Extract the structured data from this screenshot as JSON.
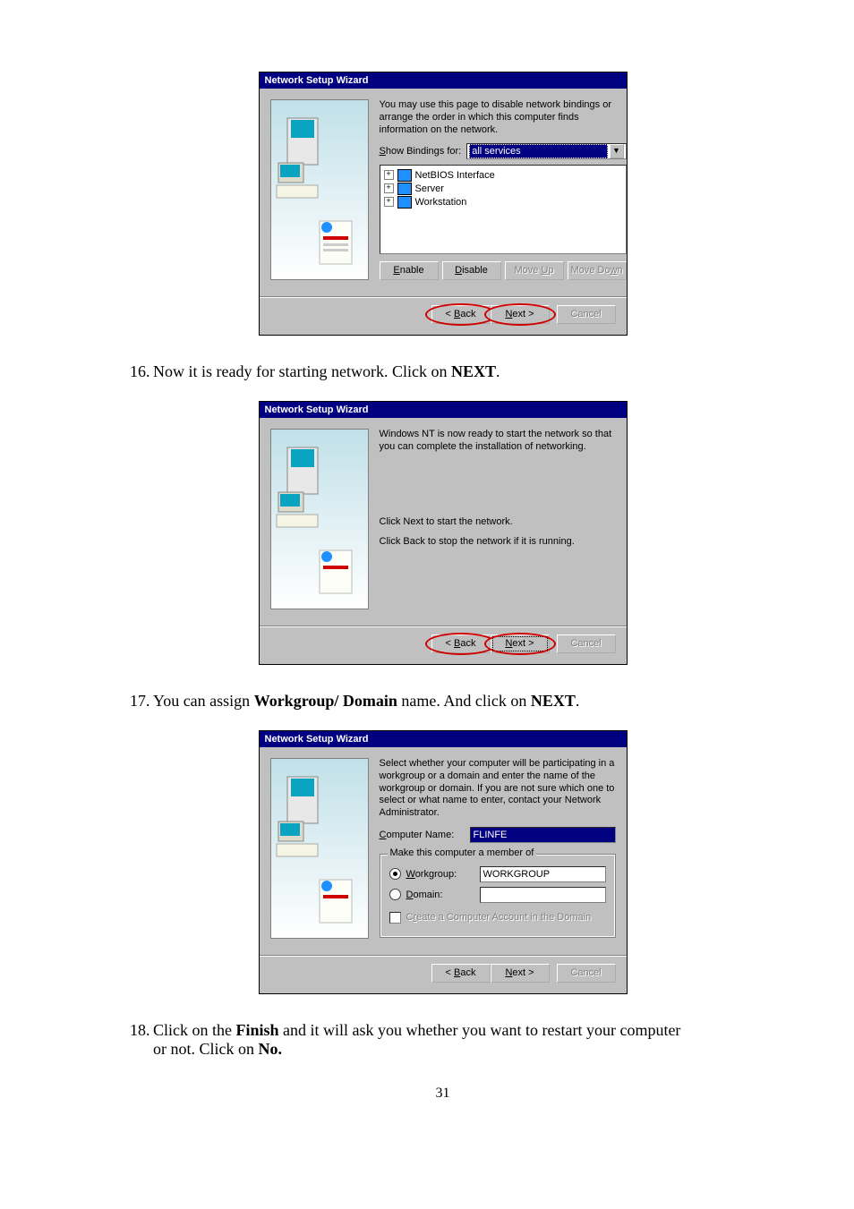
{
  "page_number": "31",
  "steps": {
    "s16": {
      "num": "16.",
      "text_before": "Now it is ready for starting network. Click on ",
      "bold": "NEXT",
      "tail": "."
    },
    "s17": {
      "num": "17.",
      "text_before": "You can assign ",
      "bold": "Workgroup/ Domain",
      "mid": " name. And click on ",
      "bold2": "NEXT",
      "tail": "."
    },
    "s18": {
      "num": "18.",
      "text_a": "Click on the ",
      "bold_a": "Finish",
      "text_b": " and it will ask you whether you want to restart your computer",
      "text_c": "or    not. Click on ",
      "bold_c": "No."
    }
  },
  "wizard_title": "Network Setup Wizard",
  "dlg1": {
    "intro": "You may use this page to disable network bindings or arrange the order in which this computer finds information on the network.",
    "show_label": "Show Bindings for:",
    "show_accel": "S",
    "combo_value": "all services",
    "tree": [
      "NetBIOS Interface",
      "Server",
      "Workstation"
    ],
    "btn_enable": "Enable",
    "btn_enable_accel": "E",
    "btn_disable": "Disable",
    "btn_disable_accel": "D",
    "btn_moveup": "Move Up",
    "btn_moveup_accel": "U",
    "btn_movedown": "Move Down",
    "btn_movedown_accel": "w",
    "btn_back": "< Back",
    "btn_back_accel": "B",
    "btn_next": "Next >",
    "btn_next_accel": "N",
    "btn_cancel": "Cancel"
  },
  "dlg2": {
    "intro": "Windows NT is now ready to start the network so that you can complete the installation of networking.",
    "line1": "Click Next to start the network.",
    "line2": "Click Back to stop the network if it is running.",
    "btn_back": "< Back",
    "btn_back_accel": "B",
    "btn_next": "Next >",
    "btn_next_accel": "N",
    "btn_cancel": "Cancel"
  },
  "dlg3": {
    "intro": "Select whether your computer will be participating in a workgroup or a domain and enter the name of the workgroup or domain. If you are not sure which one to select or what name to enter, contact your Network Administrator.",
    "comp_label": "Computer Name:",
    "comp_accel": "C",
    "comp_value": "FLINFE",
    "group_legend": "Make this computer a member of",
    "workgroup_label": "Workgroup:",
    "workgroup_accel": "W",
    "workgroup_value": "WORKGROUP",
    "domain_label": "Domain:",
    "domain_accel": "D",
    "domain_value": "",
    "create_label": "Create a Computer Account in the Domain",
    "create_accel": "r",
    "btn_back": "< Back",
    "btn_back_accel": "B",
    "btn_next": "Next >",
    "btn_next_accel": "N",
    "btn_cancel": "Cancel"
  }
}
